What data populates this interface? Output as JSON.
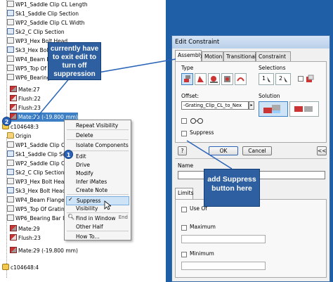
{
  "tree": {
    "rows": [
      {
        "label": "WP1_Saddle Clip CL Length",
        "icon": "workplane"
      },
      {
        "label": "Sk1_Saddle Clip Section",
        "icon": "sketch"
      },
      {
        "label": "WP2_Saddle Clip CL Width",
        "icon": "workplane"
      },
      {
        "label": "Sk2_C Clip Section",
        "icon": "sketch"
      },
      {
        "label": "WP3_Hex Bolt Head",
        "icon": "workplane"
      },
      {
        "label": "Sk3_Hex Bolt Hea",
        "icon": "sketch"
      },
      {
        "label": "WP4_Beam Flange",
        "icon": "workplane"
      },
      {
        "label": "WP5_Top Of Grati",
        "icon": "workplane"
      },
      {
        "label": "WP6_Bearing Bar Inside Fa",
        "icon": "workplane"
      },
      {
        "label": "Mate:27",
        "icon": "mate"
      },
      {
        "label": "Flush:22",
        "icon": "flush"
      },
      {
        "label": "Flush:23",
        "icon": "flush"
      },
      {
        "label": "Mate:28 (-19.800 mm)",
        "icon": "mate"
      },
      {
        "label": "c104648:3",
        "icon": "part"
      },
      {
        "label": "Origin",
        "icon": "folder"
      },
      {
        "label": "WP1_Saddle Clip CL",
        "icon": "workplane"
      },
      {
        "label": "Sk1_Saddle Clip Sec",
        "icon": "sketch"
      },
      {
        "label": "WP2_Saddle Clip CL",
        "icon": "workplane"
      },
      {
        "label": "Sk2_C Clip Section",
        "icon": "sketch"
      },
      {
        "label": "WP3_Hex Bolt Head",
        "icon": "workplane"
      },
      {
        "label": "Sk3_Hex Bolt Head",
        "icon": "sketch"
      },
      {
        "label": "WP4_Beam Flange",
        "icon": "workplane"
      },
      {
        "label": "WP5_Top Of Grating",
        "icon": "workplane"
      },
      {
        "label": "WP6_Bearing Bar In",
        "icon": "workplane"
      },
      {
        "label": "Mate:29",
        "icon": "mate"
      },
      {
        "label": "Flush:23",
        "icon": "flush"
      },
      {
        "label": "Mate:29 (-19.800 mm)",
        "icon": "mate"
      },
      {
        "label": "c104648:4",
        "icon": "part"
      }
    ]
  },
  "context_menu": {
    "items": [
      "Repeat Visibility",
      "Delete",
      "Isolate Components",
      "Edit",
      "Drive",
      "Modify",
      "Infer iMates",
      "Create Note",
      "Suppress",
      "Visibility",
      "Find in Window",
      "Other Half",
      "How To..."
    ],
    "find_shortcut": "End"
  },
  "callouts": {
    "left": "currently have to exit edit to turn off suppression",
    "right": "add Suppress button here",
    "badge1": "1",
    "badge2": "2"
  },
  "dialog": {
    "title": "Edit Constraint",
    "tabs": [
      "Assembly",
      "Motion",
      "Transitional",
      "Constraint Set"
    ],
    "type_label": "Type",
    "selections_label": "Selections",
    "offset_label": "Offset:",
    "offset_value": "-Grating_Clip_CL_to_Nex",
    "solution_label": "Solution",
    "suppress_label": "Suppress",
    "ok_label": "OK",
    "cancel_label": "Cancel",
    "expand_label": "<<",
    "help_label": "?",
    "name_label": "Name",
    "limits_tab": "Limits",
    "use_offset_label": "Use Of",
    "maximum_label": "Maximum",
    "minimum_label": "Minimum",
    "sel1": "1",
    "sel2": "2"
  }
}
